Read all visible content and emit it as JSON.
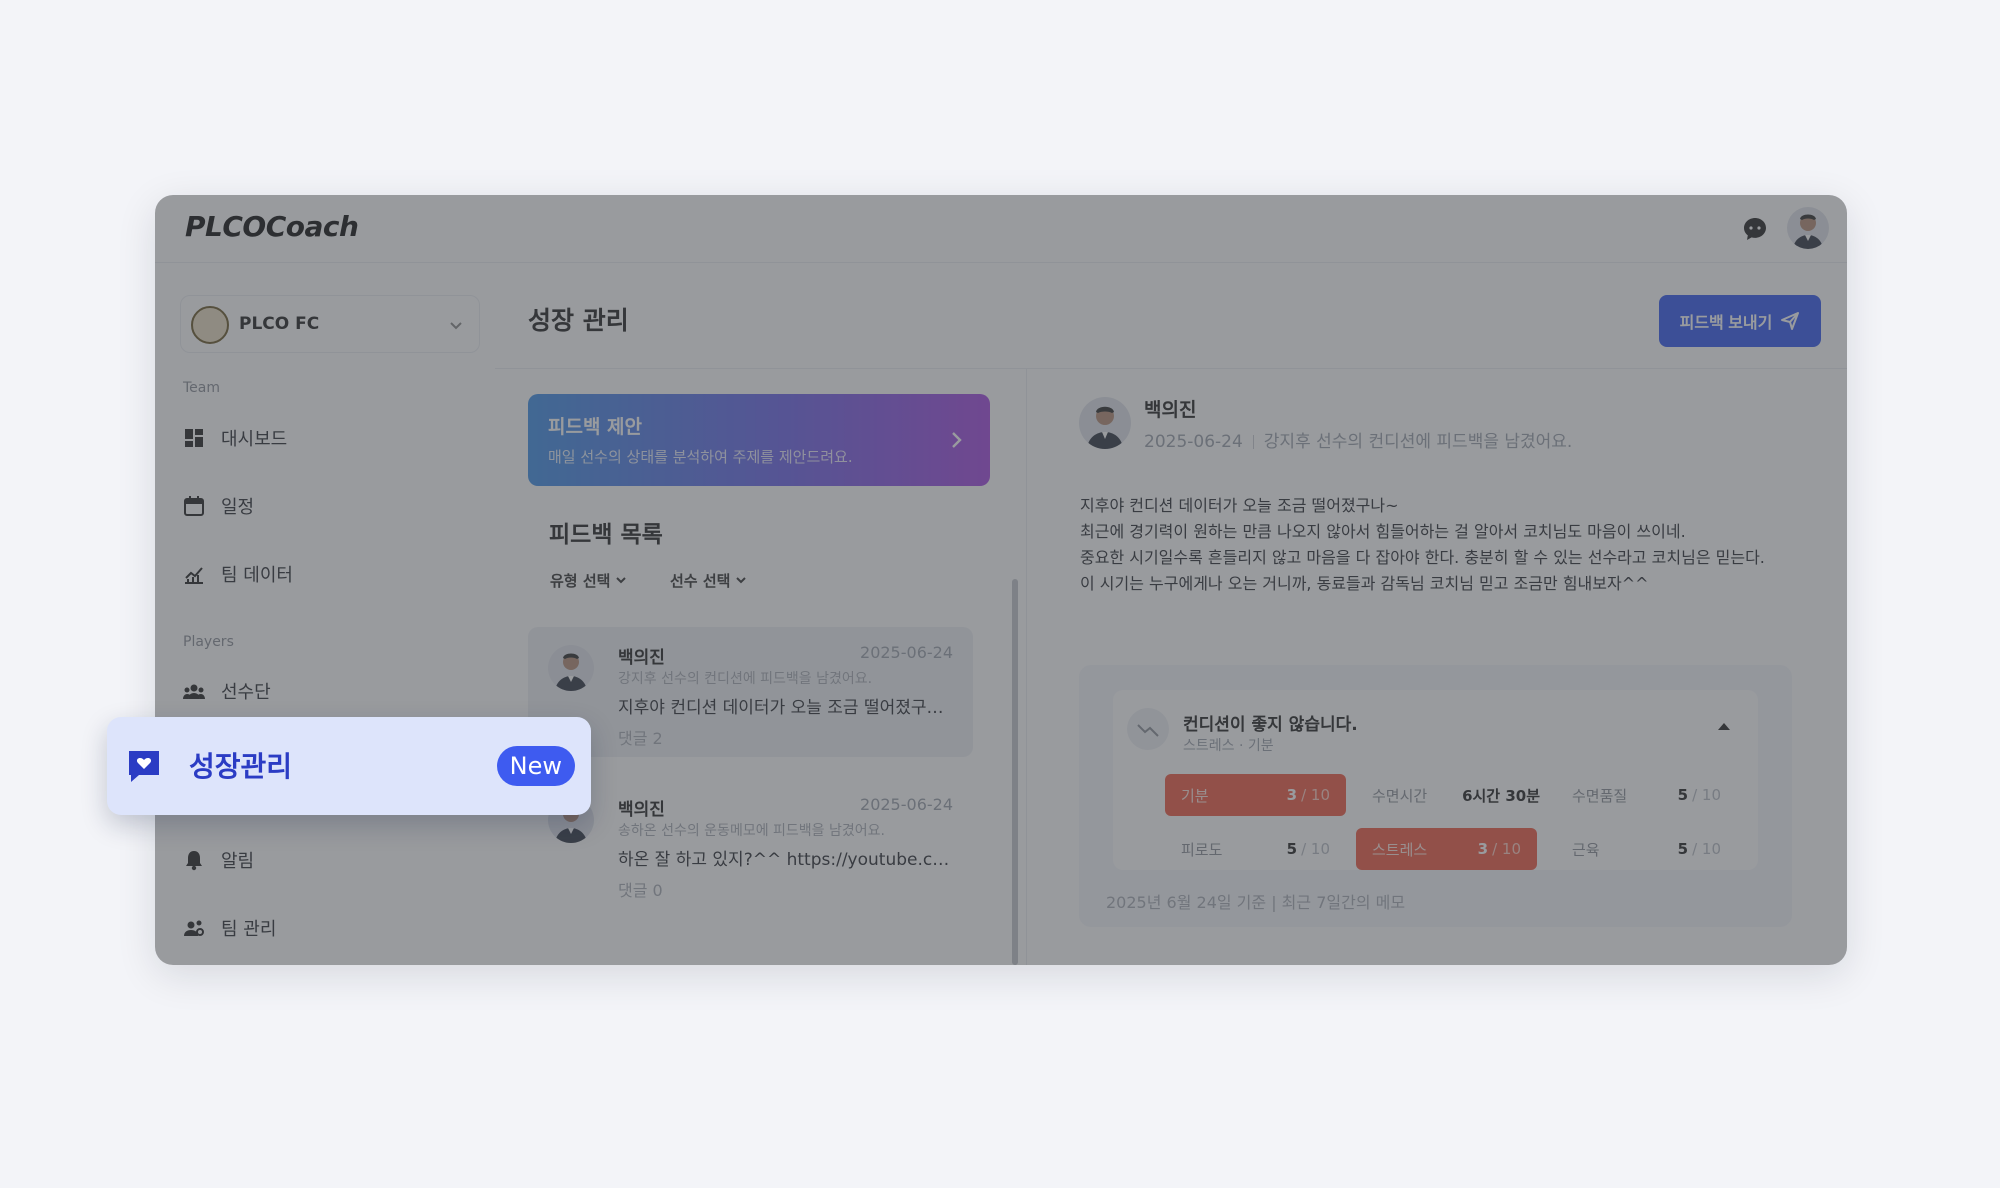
{
  "header": {
    "logo_brand": "PLCO",
    "logo_product": "Coach"
  },
  "sidebar": {
    "team_name": "PLCO FC",
    "section_team": "Team",
    "section_players": "Players",
    "items": [
      {
        "label": "대시보드",
        "icon": "dashboard-icon"
      },
      {
        "label": "일정",
        "icon": "calendar-icon"
      },
      {
        "label": "팀 데이터",
        "icon": "chart-icon"
      },
      {
        "label": "선수단",
        "icon": "people-icon"
      },
      {
        "label": "알림",
        "icon": "bell-icon"
      },
      {
        "label": "팀 관리",
        "icon": "team-manage-icon"
      }
    ]
  },
  "highlight": {
    "label": "성장관리",
    "badge": "New",
    "icon": "heart-chat-icon"
  },
  "main": {
    "title": "성장 관리",
    "send_button": "피드백 보내기",
    "suggest": {
      "title": "피드백 제안",
      "subtitle": "매일 선수의 상태를 분석하여 주제를 제안드려요."
    },
    "list_title": "피드백 목록",
    "filters": [
      "유형 선택",
      "선수 선택"
    ],
    "cards": [
      {
        "name": "백의진",
        "date": "2025-06-24",
        "sub": "강지후 선수의 컨디션에 피드백을 남겼어요.",
        "body": "지후야 컨디션 데이터가 오늘 조금 떨어졌구나...",
        "comments": "댓글 2"
      },
      {
        "name": "백의진",
        "date": "2025-06-24",
        "sub": "송하온 선수의 운동메모에 피드백을 남겼어요.",
        "body": "하온 잘 하고 있지?^^ https://youtube.com...",
        "comments": "댓글 0"
      }
    ]
  },
  "detail": {
    "name": "백의진",
    "date": "2025-06-24",
    "meta": "강지후 선수의 컨디션에 피드백을 남겼어요.",
    "body_lines": [
      "지후야 컨디션 데이터가 오늘 조금 떨어졌구나~",
      "최근에 경기력이 원하는 만큼 나오지 않아서 힘들어하는 걸 알아서 코치님도 마음이 쓰이네.",
      "중요한 시기일수록 흔들리지 않고 마음을 다 잡아야 한다. 충분히 할 수 있는 선수라고 코치님은 믿는다.",
      "이 시기는 누구에게나 오는 거니까, 동료들과 감독님 코치님 믿고 조금만 힘내보자^^"
    ],
    "condition": {
      "title": "컨디션이 좋지 않습니다.",
      "tags": "스트레스 · 기분",
      "metrics": [
        {
          "label": "기분",
          "value": "3",
          "max": "/ 10",
          "status": "bad"
        },
        {
          "label": "수면시간",
          "value": "6시간 30분",
          "max": "",
          "status": "ok"
        },
        {
          "label": "수면품질",
          "value": "5",
          "max": "/ 10",
          "status": "ok"
        },
        {
          "label": "피로도",
          "value": "5",
          "max": "/ 10",
          "status": "ok"
        },
        {
          "label": "스트레스",
          "value": "3",
          "max": "/ 10",
          "status": "bad"
        },
        {
          "label": "근육",
          "value": "5",
          "max": "/ 10",
          "status": "ok"
        }
      ],
      "footer": "2025년 6월 24일 기준 | 최근 7일간의 메모"
    }
  },
  "colors": {
    "accent": "#3158f0",
    "bad": "#f05a44",
    "highlight_bg": "#dde4fb"
  }
}
